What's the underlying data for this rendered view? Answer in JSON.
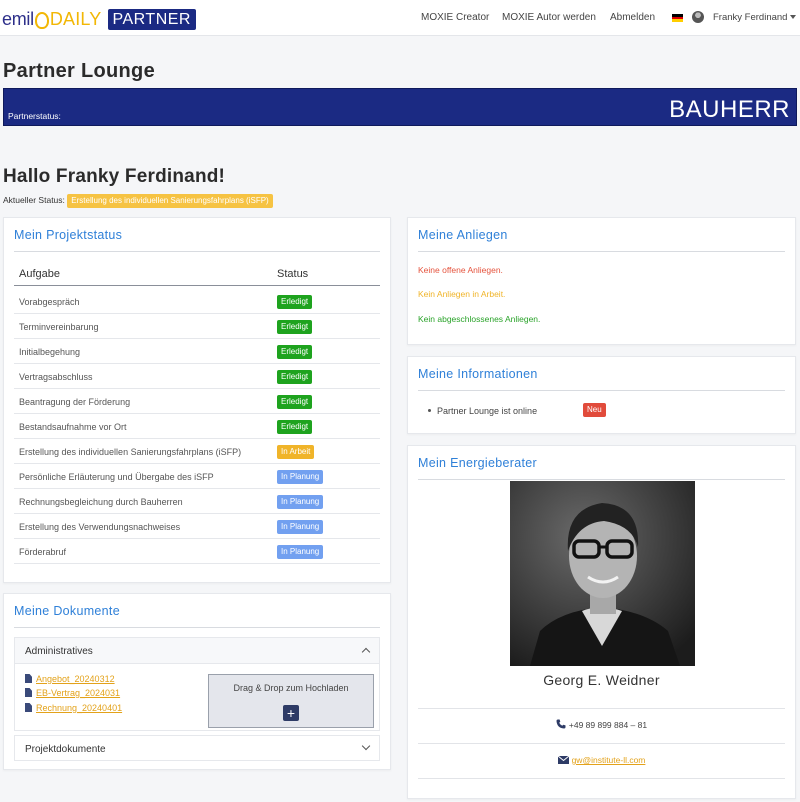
{
  "brand": {
    "emil": "emil",
    "daily": "DAILY",
    "partner": "PARTNER"
  },
  "nav": {
    "moxie_creator": "MOXIE Creator",
    "moxie_autor": "MOXIE Autor werden",
    "abmelden": "Abmelden",
    "user_name": "Franky Ferdinand"
  },
  "page": {
    "title": "Partner Lounge"
  },
  "partner_status": {
    "label": "Partnerstatus:",
    "value": "BAUHERR"
  },
  "greeting": "Hallo Franky Ferdinand!",
  "current_status": {
    "label": "Aktueller Status:",
    "value": "Erstellung des individuellen Sanierungsfahrplans (iSFP)"
  },
  "project_status": {
    "title": "Mein Projektstatus",
    "columns": [
      "Aufgabe",
      "Status"
    ],
    "rows": [
      {
        "task": "Vorabgespräch",
        "status": "Erledigt"
      },
      {
        "task": "Terminvereinbarung",
        "status": "Erledigt"
      },
      {
        "task": "Initialbegehung",
        "status": "Erledigt"
      },
      {
        "task": "Vertragsabschluss",
        "status": "Erledigt"
      },
      {
        "task": "Beantragung der Förderung",
        "status": "Erledigt"
      },
      {
        "task": "Bestandsaufnahme vor Ort",
        "status": "Erledigt"
      },
      {
        "task": "Erstellung des individuellen Sanierungsfahrplans (iSFP)",
        "status": "In Arbeit"
      },
      {
        "task": "Persönliche Erläuterung und Übergabe des iSFP",
        "status": "In Planung"
      },
      {
        "task": "Rechnungsbegleichung durch Bauherren",
        "status": "In Planung"
      },
      {
        "task": "Erstellung des Verwendungsnachweises",
        "status": "In Planung"
      },
      {
        "task": "Förderabruf",
        "status": "In Planung"
      }
    ]
  },
  "anliegen": {
    "title": "Meine Anliegen",
    "open": "Keine offene Anliegen.",
    "in_progress": "Kein Anliegen in Arbeit.",
    "closed": "Kein abgeschlossenes Anliegen."
  },
  "informationen": {
    "title": "Meine Informationen",
    "item": "Partner Lounge ist online",
    "badge": "Neu"
  },
  "energieberater": {
    "title": "Mein Energieberater",
    "name": "Georg E. Weidner",
    "phone": "+49 89 899 884 – 81",
    "email": "gw@institute-ll.com"
  },
  "dokumente": {
    "title": "Meine Dokumente",
    "section_admin": "Administratives",
    "files": [
      "Angebot_20240312",
      "EB-Vertrag_2024031",
      "Rechnung_20240401"
    ],
    "dropzone": "Drag & Drop zum Hochladen",
    "dropzone_button": "+",
    "section_project": "Projektdokumente"
  },
  "colors": {
    "brand_navy": "#1b2a83",
    "accent_blue": "#2f80d8",
    "done_green": "#1ea31e",
    "in_progress_orange": "#f0b429",
    "planned_blue": "#72a0f0",
    "new_red": "#e14b3b",
    "link_orange": "#e3a21a"
  },
  "icons": {
    "phone": "phone-icon",
    "email": "envelope-icon",
    "file": "file-icon",
    "flag": "german-flag-icon"
  }
}
